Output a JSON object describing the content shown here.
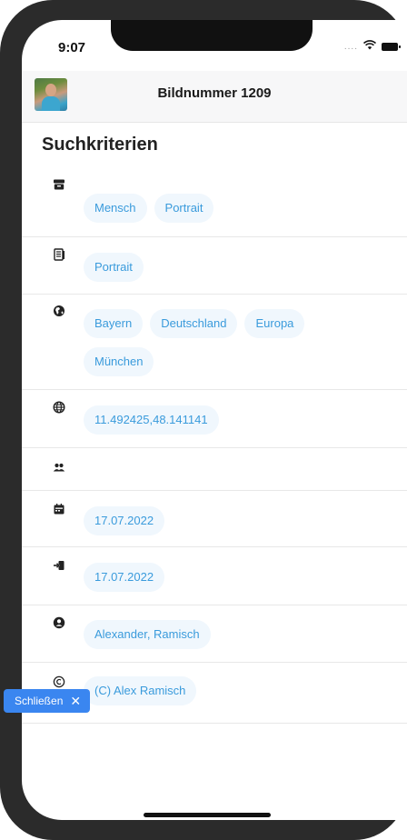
{
  "status_bar": {
    "time": "9:07",
    "signal": "....",
    "wifi_icon": "wifi-icon",
    "battery_icon": "battery-icon"
  },
  "header": {
    "title": "Bildnummer 1209",
    "avatar_icon": "avatar"
  },
  "section": {
    "title": "Suchkriterien"
  },
  "rows": [
    {
      "icon": "archive-icon",
      "chips": [
        "Mensch",
        "Portrait"
      ]
    },
    {
      "icon": "document-icon",
      "chips": [
        "Portrait"
      ]
    },
    {
      "icon": "globe-americas-icon",
      "chips": [
        "Bayern",
        "Deutschland",
        "Europa",
        "München"
      ]
    },
    {
      "icon": "globe-grid-icon",
      "chips": [
        "11.492425,48.141141"
      ]
    },
    {
      "icon": "users-icon",
      "chips": []
    },
    {
      "icon": "calendar-icon",
      "chips": [
        "17.07.2022"
      ]
    },
    {
      "icon": "sign-in-icon",
      "chips": [
        "17.07.2022"
      ]
    },
    {
      "icon": "user-circle-icon",
      "chips": [
        "Alexander, Ramisch"
      ]
    },
    {
      "icon": "copyright-icon",
      "chips": [
        "(C) Alex Ramisch"
      ]
    }
  ],
  "close_button": {
    "label": "Schließen",
    "icon": "close-icon",
    "color": "#3a86f0"
  },
  "colors": {
    "chip_background": "#f0f7fd",
    "chip_text": "#3a9bdc"
  }
}
